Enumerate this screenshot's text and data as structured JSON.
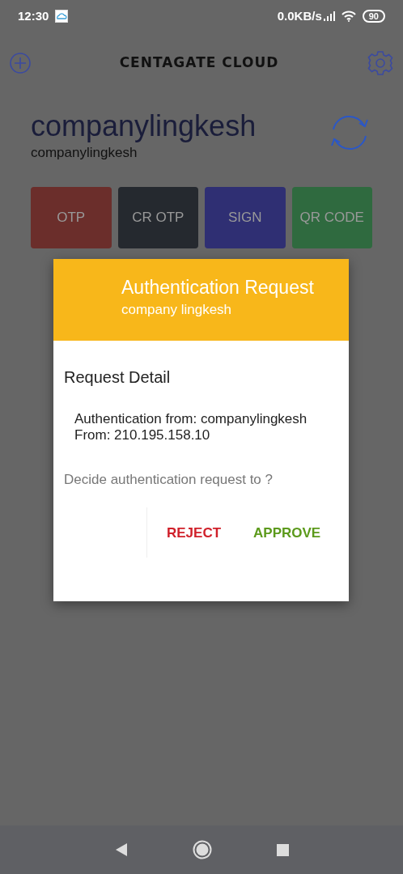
{
  "status_bar": {
    "time": "12:30",
    "net_speed": "0.0KB/s",
    "battery": "90"
  },
  "app_bar": {
    "logo": "CENTAGATE CLOUD"
  },
  "account": {
    "name": "companylingkesh",
    "subtitle": "companylingkesh"
  },
  "actions": [
    {
      "label": "OTP",
      "color": "#6b2e2b"
    },
    {
      "label": "CR OTP",
      "color": "#25292f"
    },
    {
      "label": "SIGN",
      "color": "#2f2f73"
    },
    {
      "label": "QR CODE",
      "color": "#2f6a3f"
    }
  ],
  "dialog": {
    "title": "Authentication Request",
    "subtitle": "company lingkesh",
    "section_title": "Request Detail",
    "details": [
      "Authentication from: companylingkesh",
      "From: 210.195.158.10"
    ],
    "prompt": "Decide authentication request to ?",
    "buttons": [
      {
        "label": "REJECT",
        "kind": "reject"
      },
      {
        "label": "APPROVE",
        "kind": "approve"
      }
    ]
  }
}
